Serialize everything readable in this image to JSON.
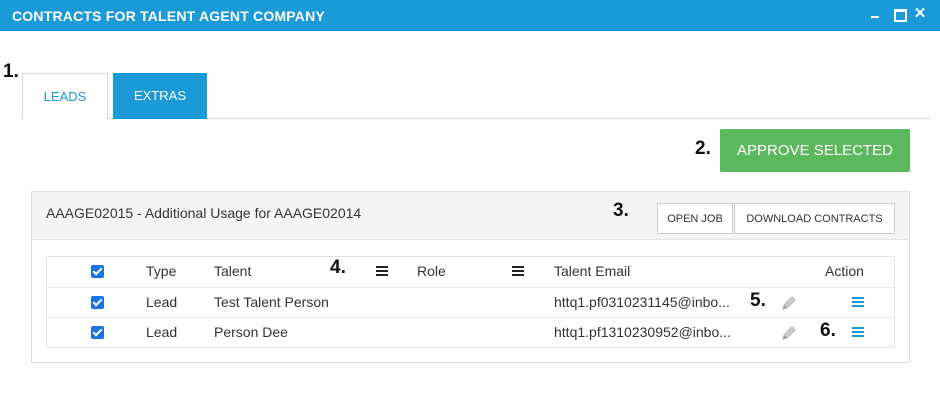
{
  "window": {
    "title": "CONTRACTS FOR TALENT AGENT COMPANY",
    "controls": [
      "minimize-icon",
      "maximize-icon",
      "close-icon"
    ],
    "close_glyph": "✕"
  },
  "callouts": [
    "1.",
    "2.",
    "3.",
    "4.",
    "5.",
    "6."
  ],
  "tabs": [
    {
      "label": "LEADS",
      "active": false
    },
    {
      "label": "EXTRAS",
      "active": true
    }
  ],
  "approve_button": {
    "label": "APPROVE SELECTED",
    "color": "#5cb85c"
  },
  "panel": {
    "title": "AAAGE02015 - Additional Usage for AAAGE02014",
    "open_job_label": "OPEN JOB",
    "download_label": "DOWNLOAD CONTRACTS"
  },
  "grid": {
    "columns": [
      "Type",
      "Talent",
      "Role",
      "Talent Email",
      "Action"
    ],
    "rows": [
      {
        "checked": true,
        "type": "Lead",
        "talent": "Test Talent Person",
        "role": "",
        "email": "httq1.pf0310231145@inbo..."
      },
      {
        "checked": true,
        "type": "Lead",
        "talent": "Person Dee",
        "role": "",
        "email": "httq1.pf1310230952@inbo..."
      }
    ]
  },
  "colors": {
    "titlebar": "#1a9ad6",
    "accent": "#1a9ad6",
    "checkbox": "#1a73e8",
    "success": "#5cb85c"
  }
}
